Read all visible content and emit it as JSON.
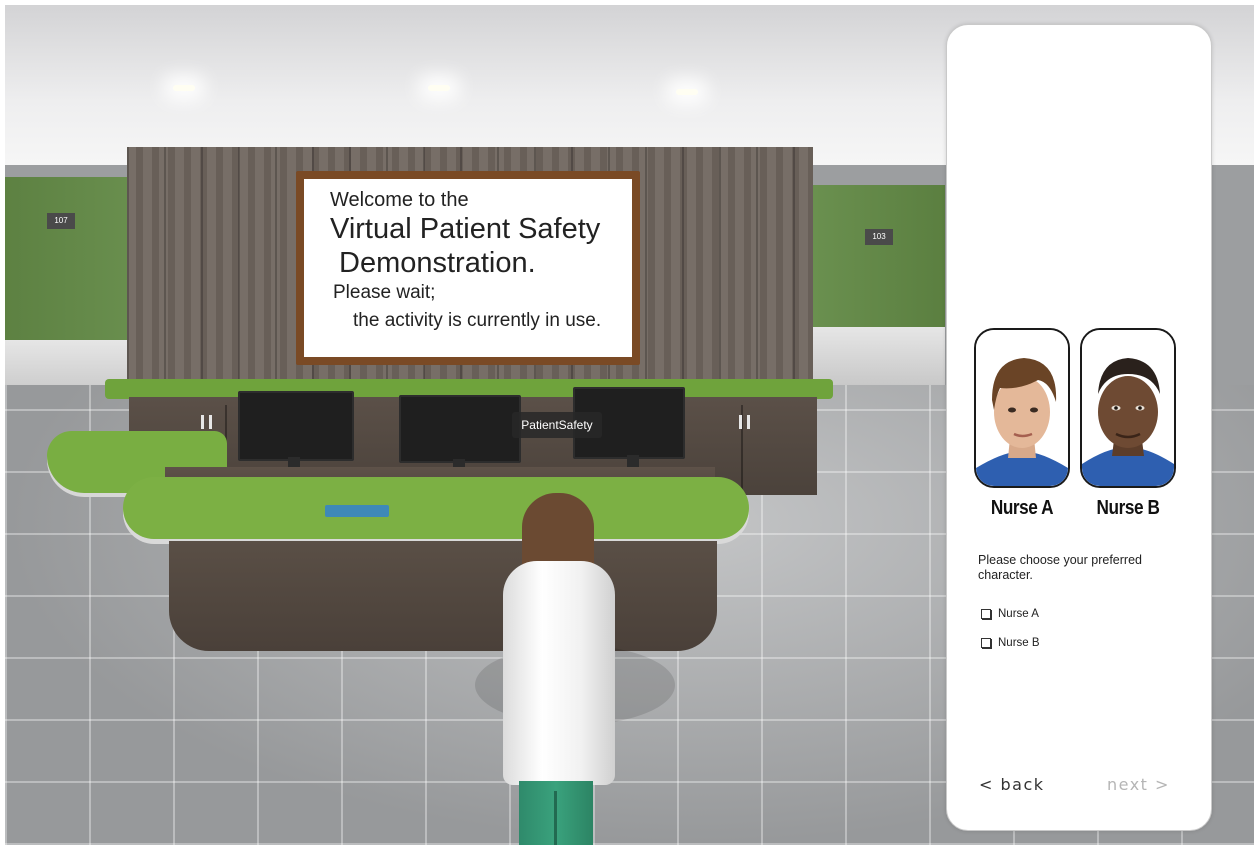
{
  "scene": {
    "sign": {
      "line1": "Welcome to the",
      "line2": "Virtual Patient Safety",
      "line3": "Demonstration.",
      "line4": "Please wait;",
      "line5": "the activity is currently in use."
    },
    "tooltip": "PatientSafety",
    "room_plates": [
      "107",
      "103"
    ]
  },
  "panel": {
    "characters": [
      {
        "label": "Nurse A",
        "icon": "nurse-a-portrait"
      },
      {
        "label": "Nurse B",
        "icon": "nurse-b-portrait"
      }
    ],
    "prompt": "Please choose your preferred character.",
    "options": [
      "Nurse A",
      "Nurse B"
    ],
    "nav": {
      "back": "< back",
      "next": "next >"
    }
  },
  "colors": {
    "accent_green": "#7cb044",
    "wall_green": "#6b9150",
    "next_disabled": "#b5b5b5"
  }
}
